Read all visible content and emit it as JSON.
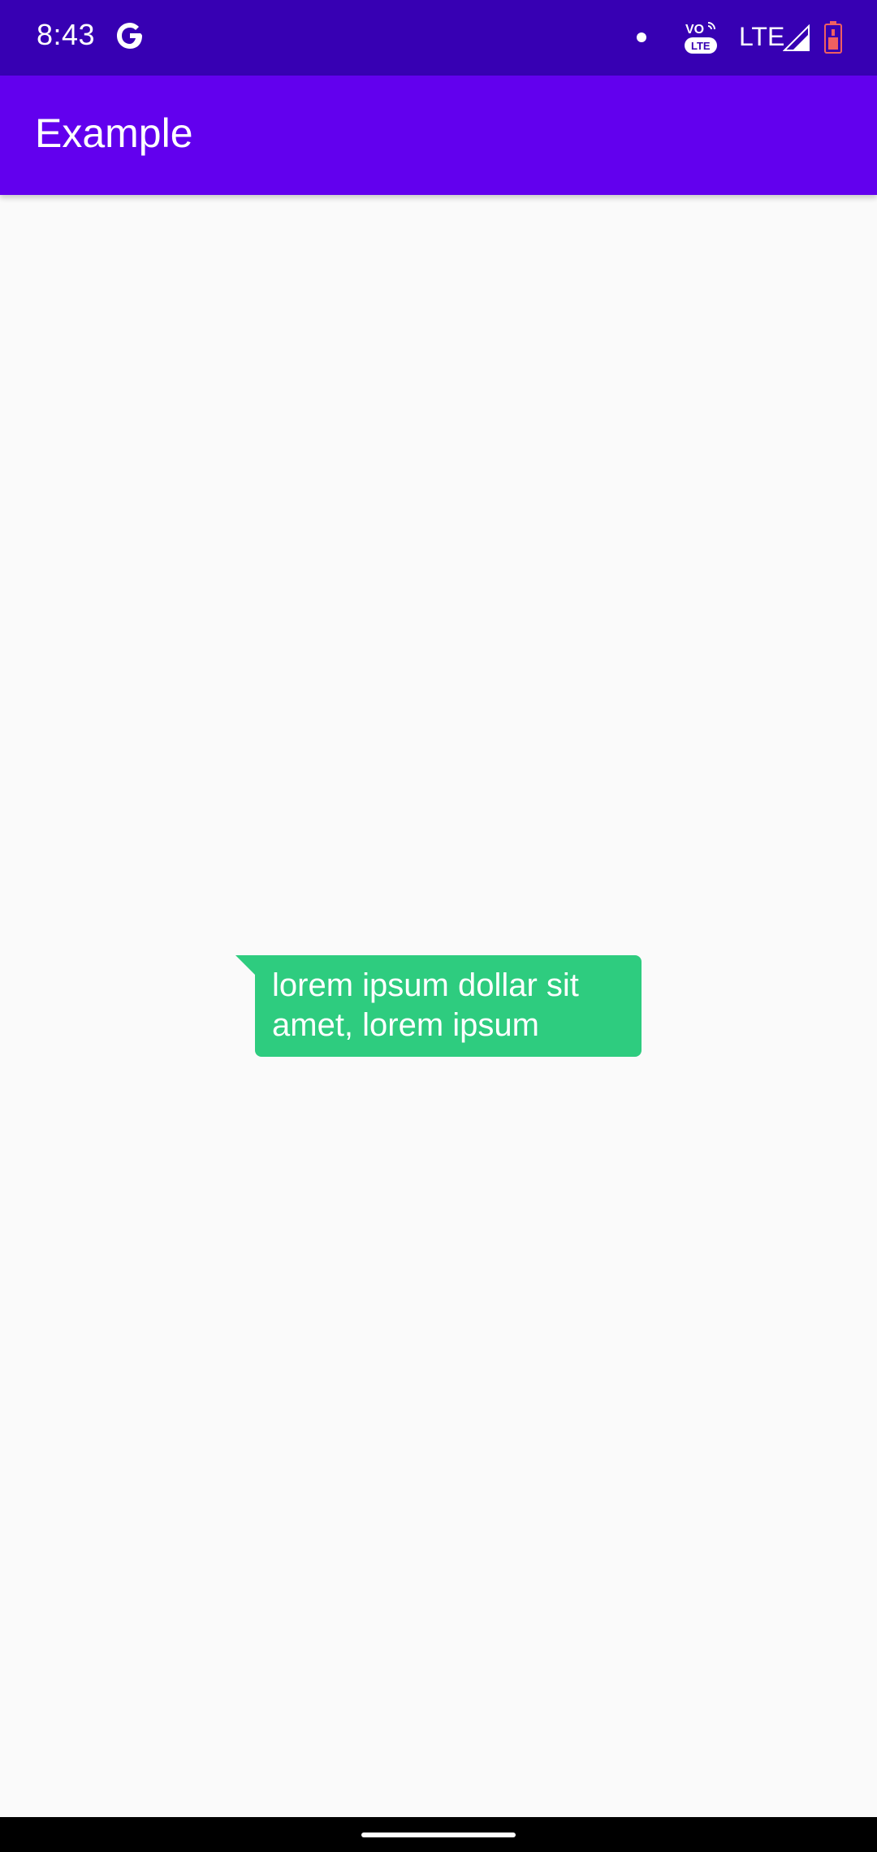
{
  "status_bar": {
    "time": "8:43",
    "network_label": "LTE",
    "icons": [
      "google-g-icon",
      "notification-dot-icon",
      "volte-icon",
      "signal-icon",
      "battery-icon"
    ]
  },
  "app_bar": {
    "title": "Example"
  },
  "content": {
    "message": "lorem ipsum dollar sit amet, lorem ipsum"
  },
  "colors": {
    "status_bar": "#3700b3",
    "app_bar": "#6200ee",
    "bubble": "#2ecc7f",
    "background": "#fafafa"
  }
}
